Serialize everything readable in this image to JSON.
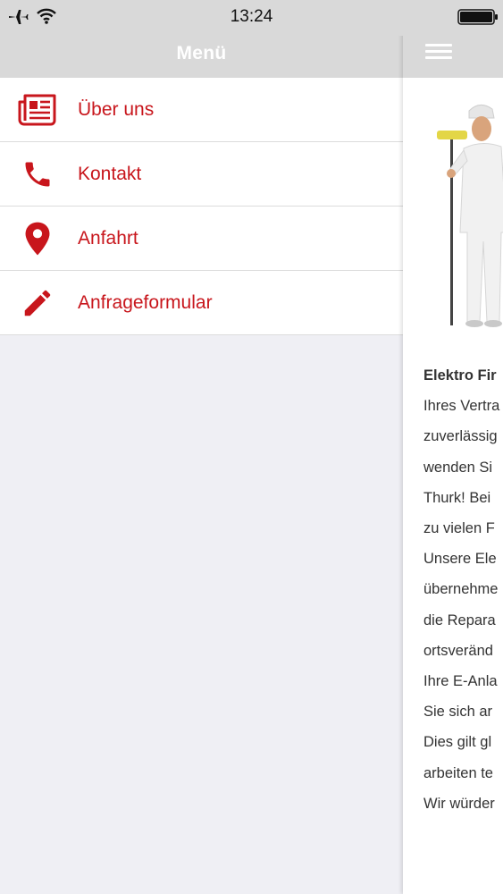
{
  "status_bar": {
    "time": "13:24"
  },
  "menu": {
    "title": "Menü",
    "items": [
      {
        "label": "Über uns",
        "icon": "newspaper-icon"
      },
      {
        "label": "Kontakt",
        "icon": "phone-icon"
      },
      {
        "label": "Anfahrt",
        "icon": "map-pin-icon"
      },
      {
        "label": "Anfrageformular",
        "icon": "pencil-icon"
      }
    ]
  },
  "content": {
    "lines": [
      "Elektro Fir",
      "Ihres Vertra",
      "zuverlässig",
      "wenden Si",
      "Thurk! Bei",
      "zu vielen F",
      "Unsere Ele",
      "übernehme",
      "die Repara",
      "ortsveränd",
      "Ihre E-Anla",
      "Sie sich ar",
      "Dies gilt gl",
      "arbeiten te",
      "Wir würder"
    ]
  },
  "colors": {
    "accent": "#c8161c",
    "header": "#d9d9d9",
    "background": "#efeff4"
  }
}
